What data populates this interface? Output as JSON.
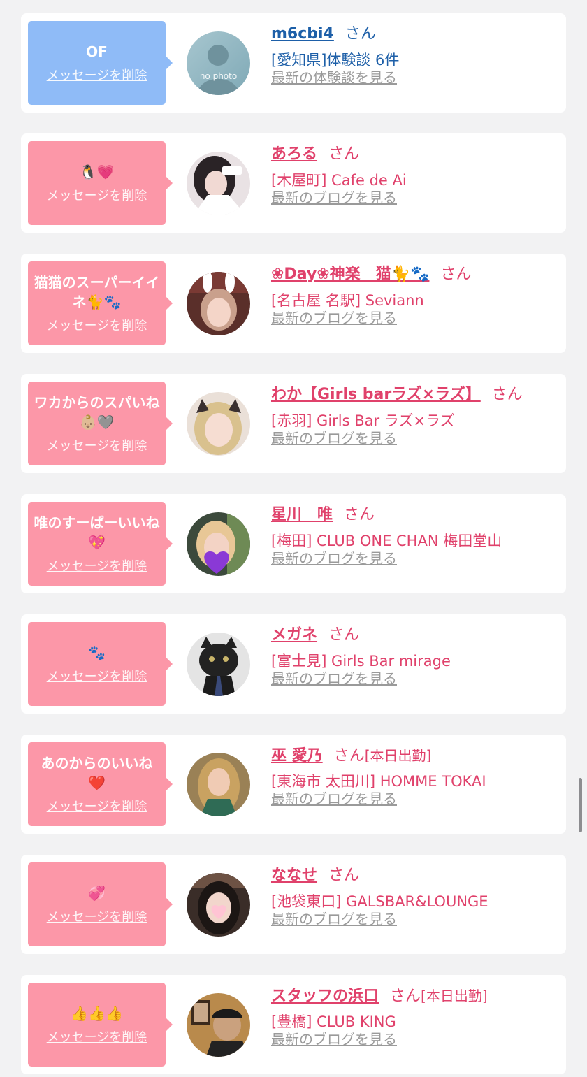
{
  "delete_label": "メッセージを削除",
  "colors": {
    "page_bg": "#f2f2f3",
    "pink_bubble": "#fc97a8",
    "blue_bubble": "#8fbbf7",
    "name_pink": "#e0416b",
    "name_blue": "#1d5fa8",
    "link_gray": "#9a9a9a"
  },
  "items": [
    {
      "bubble_color": "blue",
      "message": "OF",
      "avatar": "no-photo",
      "avatar_text": "no photo",
      "name": "m6cbi4",
      "honorific": "さん",
      "tag": "",
      "shop": "[愛知県]体験談 6件",
      "latest_link": "最新の体験談を見る"
    },
    {
      "bubble_color": "pink",
      "message": "🐧💗",
      "avatar": "girl-maid",
      "name": "あろる",
      "honorific": "さん",
      "tag": "",
      "shop": "[木屋町] Cafe de Ai",
      "latest_link": "最新のブログを見る"
    },
    {
      "bubble_color": "pink",
      "message": "猫猫のスーパーイイネ🐈🐾",
      "avatar": "girl-bunny-ears",
      "name": "❀Day❀神楽　猫🐈🐾",
      "honorific": "さん",
      "tag": "",
      "shop": "[名古屋 名駅] Seviann",
      "latest_link": "最新のブログを見る"
    },
    {
      "bubble_color": "pink",
      "message": "ワカからのスパいね👶🏼🩶",
      "avatar": "girl-cat-ears",
      "name": "わか【Girls barラズ×ラズ】",
      "honorific": "さん",
      "tag": "",
      "shop": "[赤羽] Girls Bar ラズ×ラズ",
      "latest_link": "最新のブログを見る"
    },
    {
      "bubble_color": "pink",
      "message": "唯のすーぱーいいね💖",
      "avatar": "girl-heart-cover",
      "name": "星川　唯",
      "honorific": "さん",
      "tag": "",
      "shop": "[梅田] CLUB ONE CHAN 梅田堂山",
      "latest_link": "最新のブログを見る"
    },
    {
      "bubble_color": "pink",
      "message": "🐾",
      "avatar": "black-cat",
      "name": "メガネ",
      "honorific": "さん",
      "tag": "",
      "shop": "[富士見] Girls Bar mirage",
      "latest_link": "最新のブログを見る"
    },
    {
      "bubble_color": "pink",
      "message": "あのからのいいね❤️",
      "avatar": "girl-blonde",
      "name": "巫 愛乃",
      "honorific": "さん",
      "tag": "[本日出勤]",
      "shop": "[東海市 太田川] HOMME TOKAI",
      "latest_link": "最新のブログを見る"
    },
    {
      "bubble_color": "pink",
      "message": "💞",
      "avatar": "girl-dark-hair",
      "name": "ななせ",
      "honorific": "さん",
      "tag": "",
      "shop": "[池袋東口] GALSBAR&LOUNGE",
      "latest_link": "最新のブログを見る"
    },
    {
      "bubble_color": "pink",
      "message": "👍👍👍",
      "avatar": "man-cap",
      "name": "スタッフの浜口",
      "honorific": "さん",
      "tag": "[本日出勤]",
      "shop": "[豊橋] CLUB KING",
      "latest_link": "最新のブログを見る"
    }
  ]
}
